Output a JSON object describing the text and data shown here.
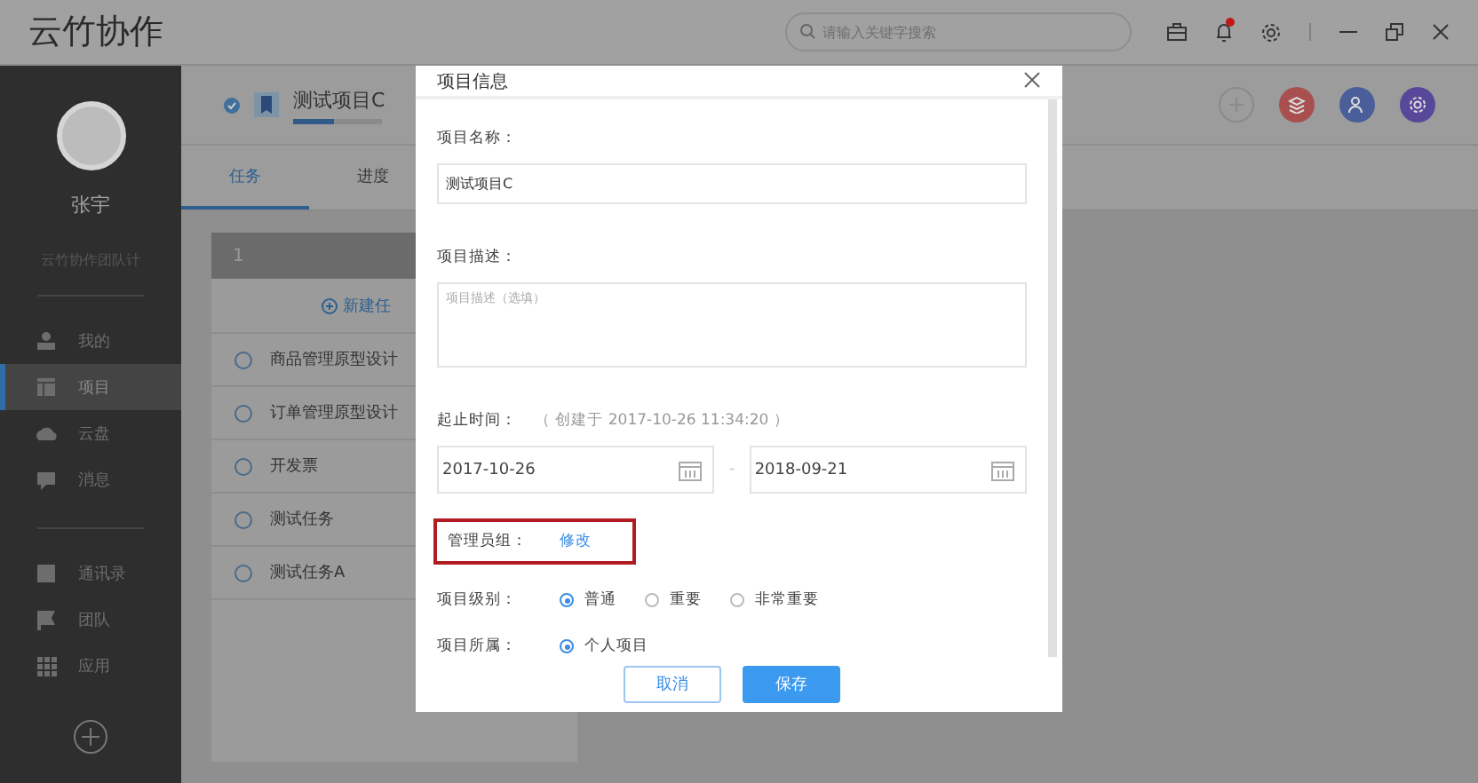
{
  "app_title": "云竹协作",
  "search": {
    "placeholder": "请输入关键字搜索"
  },
  "notifications_unread": true,
  "user": {
    "name": "张宇",
    "team": "云竹协作团队计"
  },
  "nav_groups": [
    [
      {
        "label": "我的",
        "selected": false
      },
      {
        "label": "项目",
        "selected": true
      },
      {
        "label": "云盘",
        "selected": false
      },
      {
        "label": "消息",
        "selected": false
      }
    ],
    [
      {
        "label": "通讯录",
        "selected": false
      },
      {
        "label": "团队",
        "selected": false
      },
      {
        "label": "应用",
        "selected": false
      }
    ]
  ],
  "project": {
    "name": "测试项目C",
    "level": 0.45,
    "tabs": [
      {
        "label": "任务",
        "selected": true
      },
      {
        "label": "进度",
        "selected": false
      }
    ]
  },
  "task_list": {
    "header": "1",
    "new_task": "新建任",
    "tasks": [
      {
        "title": "商品管理原型设计",
        "done": false
      },
      {
        "title": "订单管理原型设计",
        "done": false
      },
      {
        "title": "开发票",
        "done": false
      },
      {
        "title": "测试任务",
        "done": false
      },
      {
        "title": "测试任务A",
        "done": false
      }
    ]
  },
  "dialog": {
    "title": "项目信息",
    "name_label": "项目名称：",
    "name_value": "测试项目C",
    "desc_label": "项目描述：",
    "desc_placeholder": "项目描述（选填）",
    "date_label": "起止时间：",
    "created_note": "（ 创建于 2017-10-26 11:34:20 ）",
    "start_date": "2017-10-26",
    "date_separator": "-",
    "end_date": "2018-09-21",
    "admin_label": "管理员组：",
    "admin_link": "修改",
    "level_label": "项目级别：",
    "levels": [
      {
        "label": "普通",
        "selected": true
      },
      {
        "label": "重要",
        "selected": false
      },
      {
        "label": "非常重要",
        "selected": false
      }
    ],
    "owner_label": "项目所属：",
    "owners": [
      {
        "label": "个人项目",
        "selected": true
      }
    ],
    "buttons": [
      {
        "label": "取消",
        "kind": "secondary"
      },
      {
        "label": "保存",
        "kind": "primary"
      }
    ]
  }
}
